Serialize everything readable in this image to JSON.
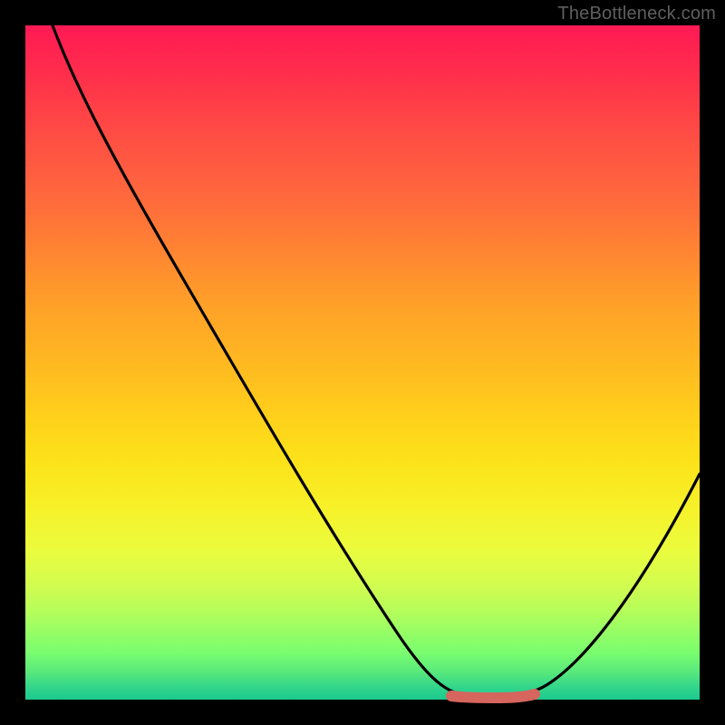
{
  "attribution": "TheBottleneck.com",
  "colors": {
    "background": "#000000",
    "gradient_top": "#ff1a55",
    "gradient_bottom": "#1bca8f",
    "curve": "#000000",
    "marker": "#d6655e",
    "attribution_text": "#5f5f5f"
  },
  "chart_data": {
    "type": "line",
    "title": "",
    "xlabel": "",
    "ylabel": "",
    "xlim": [
      0,
      100
    ],
    "ylim": [
      0,
      100
    ],
    "grid": false,
    "legend": false,
    "annotations": [
      "TheBottleneck.com"
    ],
    "series": [
      {
        "name": "bottleneck-curve",
        "x": [
          4,
          10,
          18,
          26,
          34,
          42,
          50,
          55,
          60,
          64,
          68,
          72,
          76,
          82,
          88,
          94,
          100
        ],
        "values": [
          100,
          91,
          79,
          67,
          55,
          43,
          31,
          23,
          15,
          8,
          3,
          1,
          1,
          5,
          13,
          23,
          34
        ]
      }
    ],
    "marker_segment": {
      "x_start": 64,
      "x_end": 76,
      "y": 1
    }
  }
}
